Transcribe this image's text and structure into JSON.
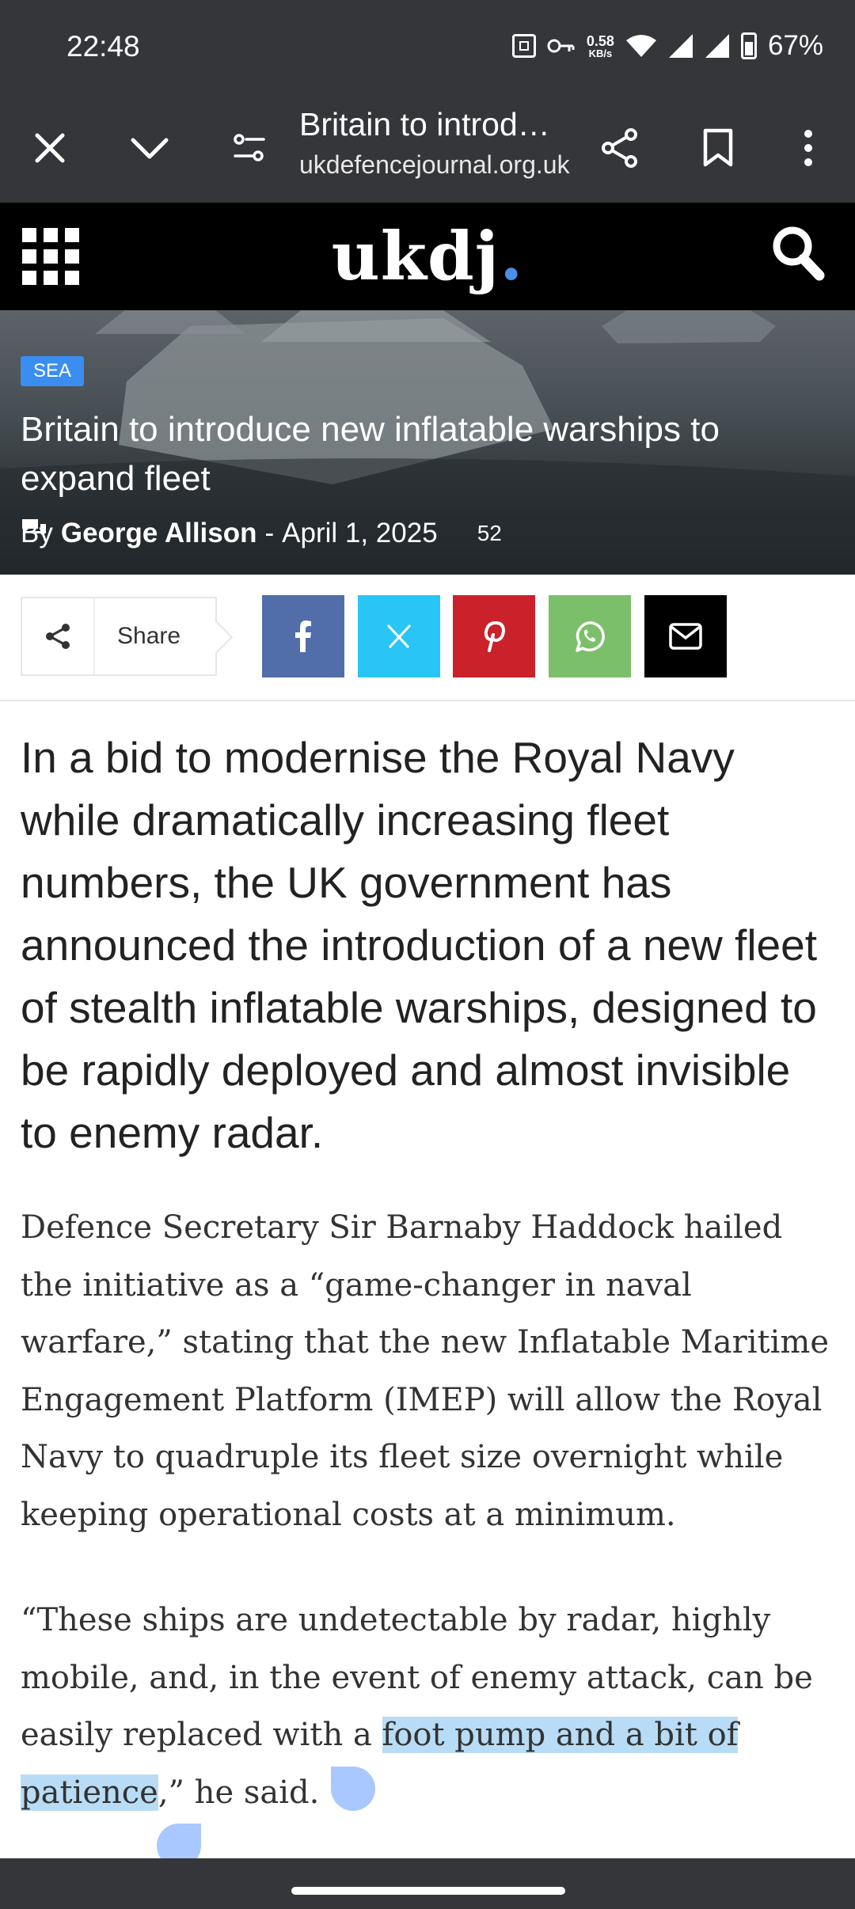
{
  "status_bar": {
    "time": "22:48",
    "speed_value": "0.58",
    "speed_unit": "KB/s",
    "battery": "67%",
    "icons": [
      "nfc-icon",
      "vpn-key-icon",
      "wifi-icon",
      "signal-icon",
      "signal-icon",
      "battery-icon"
    ]
  },
  "browser": {
    "title": "Britain to introd…",
    "url": "ukdefencejournal.org.uk",
    "icons": [
      "close-icon",
      "chevron-down-icon",
      "page-settings-icon",
      "share-icon",
      "bookmark-icon",
      "more-vert-icon"
    ]
  },
  "site": {
    "logo_text": "ukdj",
    "logo_dot": ".",
    "accent_color": "#4a8fe8",
    "icons": [
      "grid-menu-icon",
      "search-icon"
    ]
  },
  "hero": {
    "category": "SEA",
    "title": "Britain to introduce new inflatable warships to expand fleet",
    "by_prefix": "By",
    "author": "George Allison",
    "separator": "-",
    "date": "April 1, 2025",
    "comment_count": "52"
  },
  "share": {
    "label": "Share",
    "buttons": [
      {
        "name": "facebook",
        "color": "#516eab"
      },
      {
        "name": "x-twitter",
        "color": "#29c5f6"
      },
      {
        "name": "pinterest",
        "color": "#ca212a"
      },
      {
        "name": "whatsapp",
        "color": "#7bbf6a"
      },
      {
        "name": "email",
        "color": "#000000"
      }
    ]
  },
  "article": {
    "lead": "In a bid to modernise the Royal Navy while dramatically increasing fleet numbers, the UK government has announced the introduction of a new fleet of stealth inflatable warships, designed to be rapidly deployed and almost invisible to enemy radar.",
    "para1": "Defence Secretary Sir Barnaby Haddock hailed the initiative as a “game-changer in naval warfare,” stating that the new Inflatable Maritime Engagement Platform (IMEP) will allow the Royal Navy to quadruple its fleet size overnight while keeping operational costs at a minimum.",
    "quote_before": "“These ships are undetectable by radar, highly mobile, and, in the event of enemy attack, can be easily replaced with a ",
    "quote_highlight": "foot pump and a bit of patience",
    "quote_after": ",” he said.",
    "highlight_color": "#b8dcf5"
  }
}
